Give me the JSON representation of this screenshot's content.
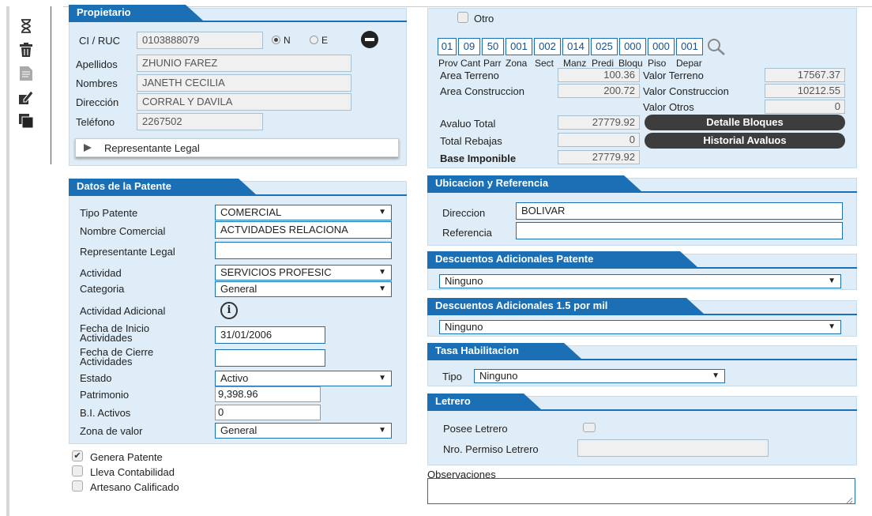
{
  "toolbar": {
    "icons": [
      "hourglass-icon",
      "trash-icon",
      "document-icon",
      "edit-icon",
      "copy-icon"
    ]
  },
  "propietario": {
    "title": "Propietario",
    "ci_label": "CI / RUC",
    "ci_value": "0103888079",
    "radio_n": "N",
    "radio_e": "E",
    "apellidos_label": "Apellidos",
    "apellidos_value": "ZHUNIO FAREZ",
    "nombres_label": "Nombres",
    "nombres_value": "JANETH CECILIA",
    "direccion_label": "Dirección",
    "direccion_value": "CORRAL Y DAVILA",
    "telefono_label": "Teléfono",
    "telefono_value": "2267502",
    "rep_legal_label": "Representante Legal"
  },
  "predio": {
    "otro_label": "Otro",
    "codes": [
      "01",
      "09",
      "50",
      "001",
      "002",
      "014",
      "025",
      "000",
      "000",
      "001"
    ],
    "code_headers": [
      "Prov",
      "Cant",
      "Parr",
      "Zona",
      "Sect",
      "Manz",
      "Predi",
      "Bloqu",
      "Piso",
      "Depar"
    ],
    "area_terreno_label": "Area Terreno",
    "area_terreno": "100.36",
    "valor_terreno_label": "Valor Terreno",
    "valor_terreno": "17567.37",
    "area_construccion_label": "Area Construccion",
    "area_construccion": "200.72",
    "valor_construccion_label": "Valor Construccion",
    "valor_construccion": "10212.55",
    "valor_otros_label": "Valor Otros",
    "valor_otros": "0",
    "avaluo_total_label": "Avaluo Total",
    "avaluo_total": "27779.92",
    "total_rebajas_label": "Total Rebajas",
    "total_rebajas": "0",
    "base_imponible_label": "Base Imponible",
    "base_imponible": "27779.92",
    "detalle_bloques": "Detalle Bloques",
    "historial_avaluos": "Historial Avaluos"
  },
  "patente": {
    "title": "Datos de la Patente",
    "tipo_label": "Tipo Patente",
    "tipo_value": "COMERCIAL",
    "nombre_label": "Nombre Comercial",
    "nombre_value": "ACTVIDADES RELACIONA",
    "rep_label": "Representante Legal",
    "rep_value": "",
    "actividad_label": "Actividad",
    "actividad_value": "SERVICIOS PROFESIC",
    "categoria_label": "Categoria",
    "categoria_value": "General",
    "act_adicional_label": "Actividad Adicional",
    "fecha_inicio_label": "Fecha de Inicio Actividades",
    "fecha_inicio_value": "31/01/2006",
    "fecha_cierre_label": "Fecha de Cierre Actividades",
    "fecha_cierre_value": "",
    "estado_label": "Estado",
    "estado_value": "Activo",
    "patrimonio_label": "Patrimonio",
    "patrimonio_value": "9,398.96",
    "bi_label": "B.I. Activos",
    "bi_value": "0",
    "zona_label": "Zona de valor",
    "zona_value": "General"
  },
  "checks": {
    "genera": "Genera Patente",
    "lleva": "Lleva Contabilidad",
    "artesano": "Artesano Calificado"
  },
  "ubicacion": {
    "title": "Ubicacion y Referencia",
    "direccion_label": "Direccion",
    "direccion_value": "BOLIVAR",
    "referencia_label": "Referencia",
    "referencia_value": ""
  },
  "desc_patente": {
    "title": "Descuentos Adicionales Patente",
    "value": "Ninguno"
  },
  "desc_mil": {
    "title": "Descuentos Adicionales 1.5 por mil",
    "value": "Ninguno"
  },
  "tasa": {
    "title": "Tasa Habilitacion",
    "tipo_label": "Tipo",
    "tipo_value": "Ninguno"
  },
  "letrero": {
    "title": "Letrero",
    "posee_label": "Posee Letrero",
    "permiso_label": "Nro. Permiso Letrero",
    "permiso_value": ""
  },
  "observaciones": {
    "label": "Observaciones",
    "value": ""
  }
}
